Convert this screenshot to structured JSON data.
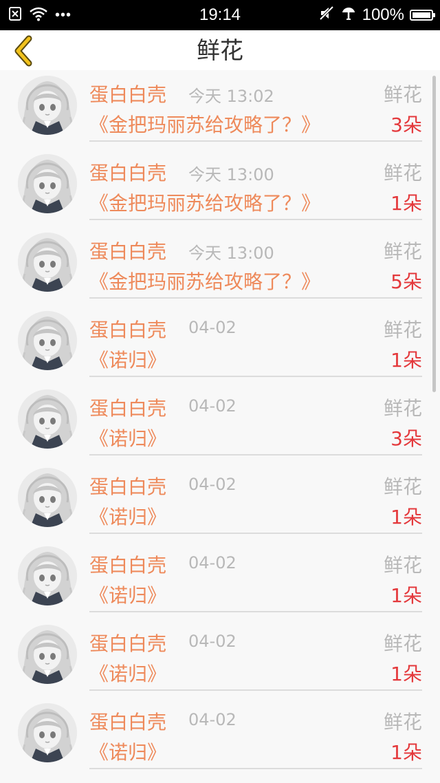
{
  "status_bar": {
    "time": "19:14",
    "battery": "100%",
    "more_dots": "•••",
    "left_icons": [
      "sim-icon",
      "wifi-icon",
      "more-icon"
    ],
    "right_icons": [
      "mute-icon",
      "data-icon",
      "battery-icon"
    ]
  },
  "nav": {
    "title": "鲜花",
    "back_icon": "chevron-left-icon",
    "accent_color": "#f2c21c"
  },
  "colors": {
    "name": "#ee8a5b",
    "count": "#e4393c",
    "muted": "#b8b8b8"
  },
  "rows": [
    {
      "user": "蛋白白壳",
      "time": "今天 13:02",
      "type": "鲜花",
      "title": "《金把玛丽苏给攻略了？》",
      "count": "3朵"
    },
    {
      "user": "蛋白白壳",
      "time": "今天 13:00",
      "type": "鲜花",
      "title": "《金把玛丽苏给攻略了？》",
      "count": "1朵"
    },
    {
      "user": "蛋白白壳",
      "time": "今天 13:00",
      "type": "鲜花",
      "title": "《金把玛丽苏给攻略了？》",
      "count": "5朵"
    },
    {
      "user": "蛋白白壳",
      "time": "04-02",
      "type": "鲜花",
      "title": "《诺归》",
      "count": "1朵"
    },
    {
      "user": "蛋白白壳",
      "time": "04-02",
      "type": "鲜花",
      "title": "《诺归》",
      "count": "3朵"
    },
    {
      "user": "蛋白白壳",
      "time": "04-02",
      "type": "鲜花",
      "title": "《诺归》",
      "count": "1朵"
    },
    {
      "user": "蛋白白壳",
      "time": "04-02",
      "type": "鲜花",
      "title": "《诺归》",
      "count": "1朵"
    },
    {
      "user": "蛋白白壳",
      "time": "04-02",
      "type": "鲜花",
      "title": "《诺归》",
      "count": "1朵"
    },
    {
      "user": "蛋白白壳",
      "time": "04-02",
      "type": "鲜花",
      "title": "《诺归》",
      "count": "1朵"
    }
  ]
}
